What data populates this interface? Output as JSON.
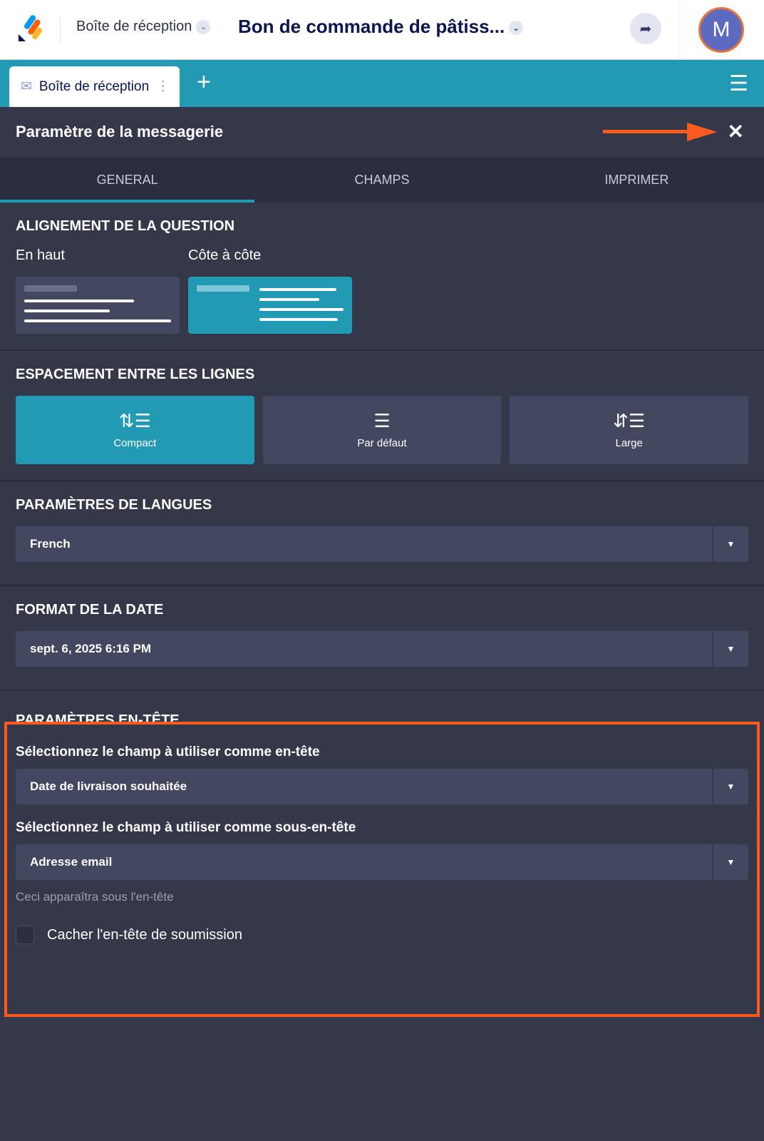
{
  "header": {
    "breadcrumb": "Boîte de réception",
    "form_title": "Bon de commande de pâtiss...",
    "avatar_initial": "M"
  },
  "tabbar": {
    "tab_label": "Boîte de réception"
  },
  "panel": {
    "title": "Paramètre de la messagerie",
    "tabs": [
      "GENERAL",
      "CHAMPS",
      "IMPRIMER"
    ]
  },
  "alignment": {
    "heading": "ALIGNEMENT DE LA QUESTION",
    "options": [
      "En haut",
      "Côte à côte"
    ]
  },
  "spacing": {
    "heading": "ESPACEMENT ENTRE LES LIGNES",
    "options": [
      "Compact",
      "Par défaut",
      "Large"
    ]
  },
  "language": {
    "heading": "PARAMÈTRES DE LANGUES",
    "value": "French"
  },
  "date": {
    "heading": "FORMAT DE LA DATE",
    "value": "sept. 6, 2025 6:16 PM"
  },
  "header_settings": {
    "heading": "PARAMÈTRES EN-TÊTE",
    "header_label": "Sélectionnez le champ à utiliser comme en-tête",
    "header_value": "Date de livraison souhaitée",
    "subheader_label": "Sélectionnez le champ à utiliser comme sous-en-tête",
    "subheader_value": "Adresse email",
    "hint": "Ceci apparaîtra sous l'en-tête",
    "checkbox_label": "Cacher l'en-tête de soumission"
  },
  "colors": {
    "accent": "#239ab3",
    "highlight": "#ff5a1f"
  }
}
